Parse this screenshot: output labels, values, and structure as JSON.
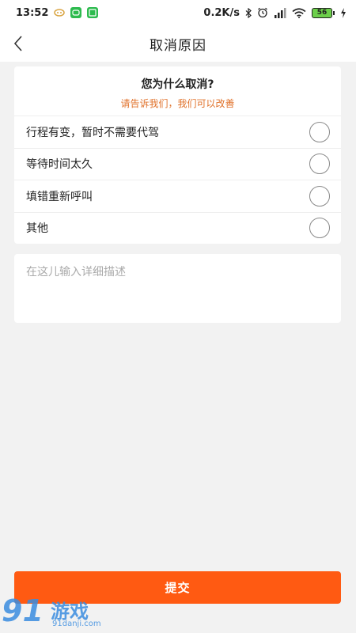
{
  "status_bar": {
    "time": "13:52",
    "net_speed": "0.2K/s",
    "battery": "56"
  },
  "nav": {
    "title": "取消原因"
  },
  "card": {
    "question": "您为什么取消?",
    "hint": "请告诉我们，我们可以改善",
    "options": [
      {
        "label": "行程有变，暂时不需要代驾",
        "selected": false
      },
      {
        "label": "等待时间太久",
        "selected": false
      },
      {
        "label": "填错重新呼叫",
        "selected": false
      },
      {
        "label": "其他",
        "selected": false
      }
    ]
  },
  "description": {
    "placeholder": "在这儿输入详细描述",
    "value": ""
  },
  "submit": {
    "label": "提交"
  },
  "colors": {
    "accent": "#ff5a12",
    "hint": "#e0712a",
    "background": "#f2f2f2"
  },
  "watermark": {
    "logo": "91",
    "text": "游戏",
    "url": "91danji.com"
  }
}
